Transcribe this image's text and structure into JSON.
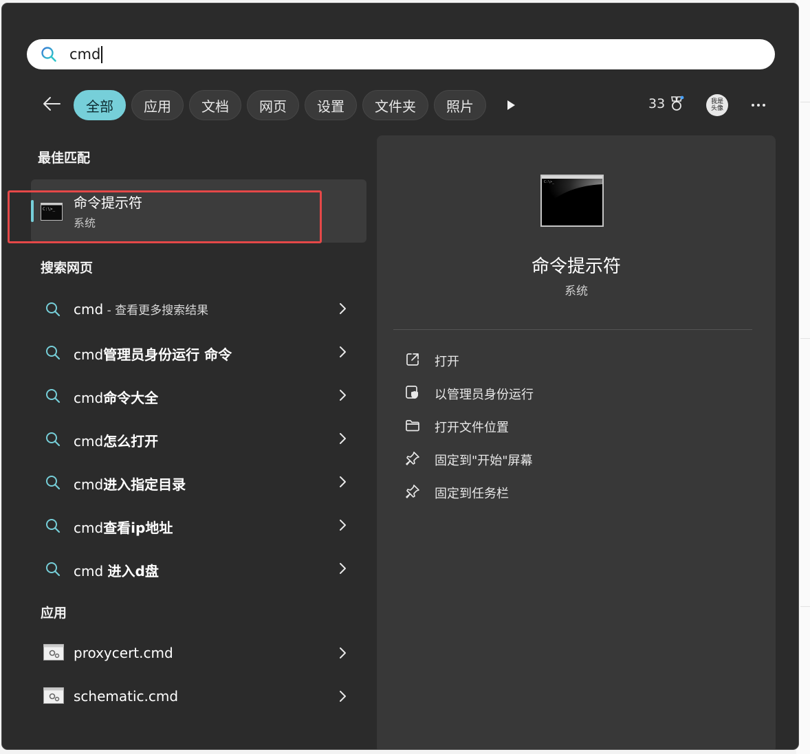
{
  "search": {
    "value": "cmd",
    "placeholder": ""
  },
  "filters": {
    "active": "全部",
    "chips": [
      "全部",
      "应用",
      "文档",
      "网页",
      "设置",
      "文件夹",
      "照片"
    ]
  },
  "header": {
    "points": "33",
    "avatar_text": "我是头像"
  },
  "best_match": {
    "section": "最佳匹配",
    "title": "命令提示符",
    "subtitle": "系统",
    "preview_text": "C:\\>_"
  },
  "web_search": {
    "section": "搜索网页",
    "items": [
      {
        "main": "cmd",
        "suffix": " - 查看更多搜索结果",
        "bold": ""
      },
      {
        "main": "cmd",
        "suffix": "",
        "bold": "管理员身份运行 命令"
      },
      {
        "main": "cmd",
        "suffix": "",
        "bold": "命令大全"
      },
      {
        "main": "cmd",
        "suffix": "",
        "bold": "怎么打开"
      },
      {
        "main": "cmd",
        "suffix": "",
        "bold": "进入指定目录"
      },
      {
        "main": "cmd",
        "suffix": "",
        "bold": "查看ip地址"
      },
      {
        "main": "cmd ",
        "suffix": "",
        "bold": "进入d盘"
      }
    ]
  },
  "apps": {
    "section": "应用",
    "items": [
      {
        "label": "proxycert.cmd"
      },
      {
        "label": "schematic.cmd"
      }
    ]
  },
  "detail": {
    "title": "命令提示符",
    "subtitle": "系统",
    "actions": [
      {
        "label": "打开",
        "icon": "open-external-icon"
      },
      {
        "label": "以管理员身份运行",
        "icon": "admin-shield-icon"
      },
      {
        "label": "打开文件位置",
        "icon": "folder-icon"
      },
      {
        "label": "固定到\"开始\"屏幕",
        "icon": "pin-icon"
      },
      {
        "label": "固定到任务栏",
        "icon": "pin-icon"
      }
    ]
  },
  "colors": {
    "accent": "#76cfd9",
    "panel": "#2b2b2b",
    "highlight_box": "#e54848"
  }
}
